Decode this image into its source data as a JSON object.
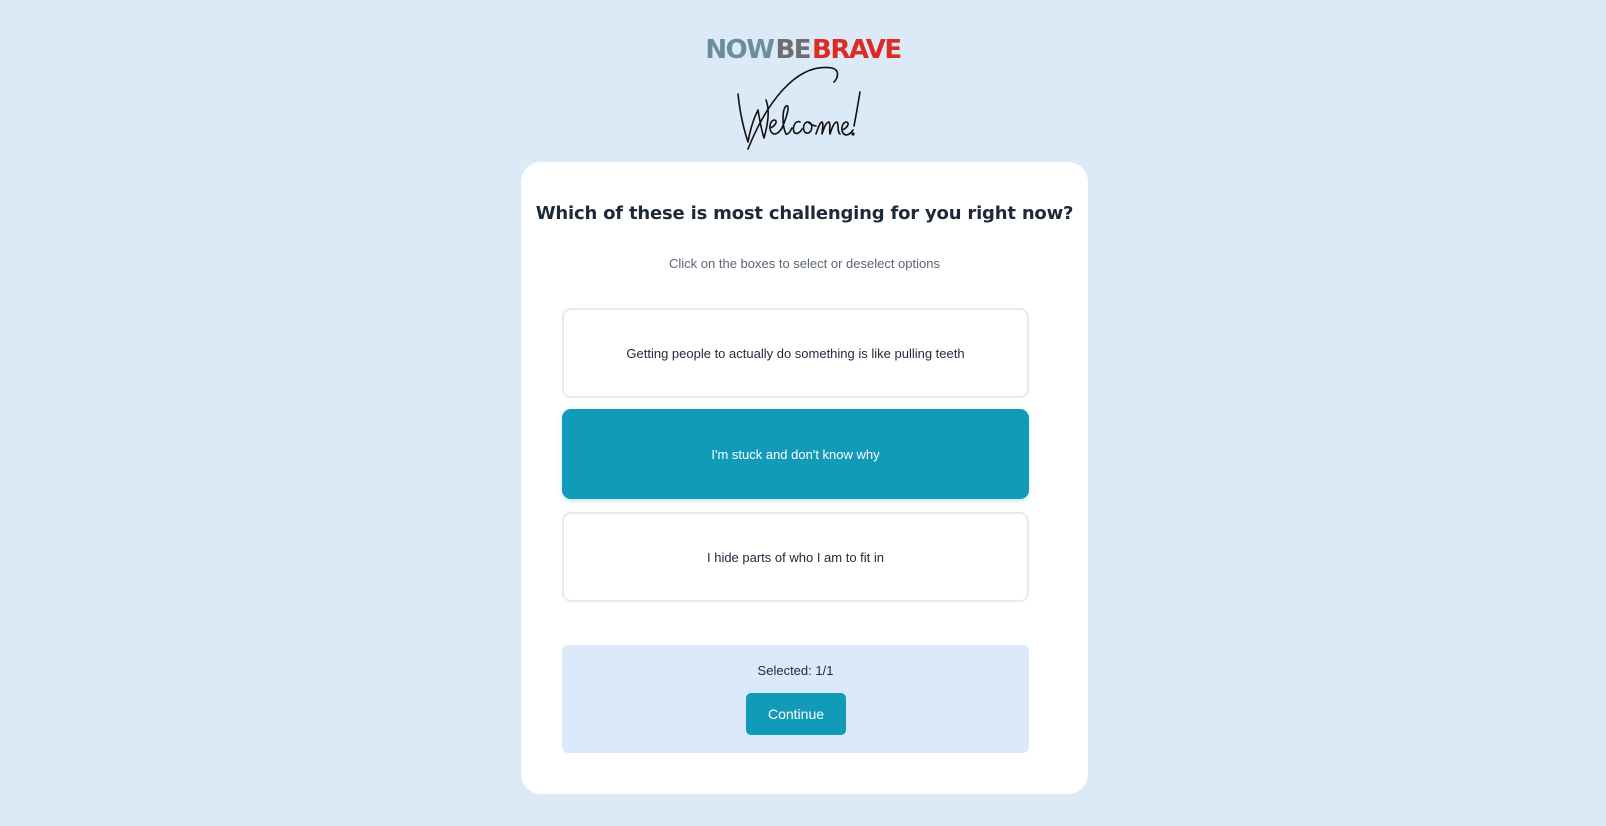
{
  "brand": {
    "logo_word_1": "NOW",
    "logo_word_2": "BE",
    "logo_word_3": "BRAVE",
    "welcome_script": "Welcome!",
    "colors": {
      "now": "#6b8f9a",
      "be": "#6e6e72",
      "brave": "#dc2a25"
    }
  },
  "quiz": {
    "question": "Which of these is most challenging for you right now?",
    "instruction": "Click on the boxes to select or deselect options",
    "options": [
      {
        "label": "Getting people to actually do something is like pulling teeth",
        "selected": false
      },
      {
        "label": "I'm stuck and don't know why",
        "selected": true
      },
      {
        "label": "I hide parts of who I am to fit in",
        "selected": false
      }
    ],
    "selected_count": "Selected: 1/1",
    "continue_label": "Continue"
  },
  "colors": {
    "background": "#dce9f6",
    "accent": "#129ab9",
    "footer_bg": "#dbe9fb"
  }
}
